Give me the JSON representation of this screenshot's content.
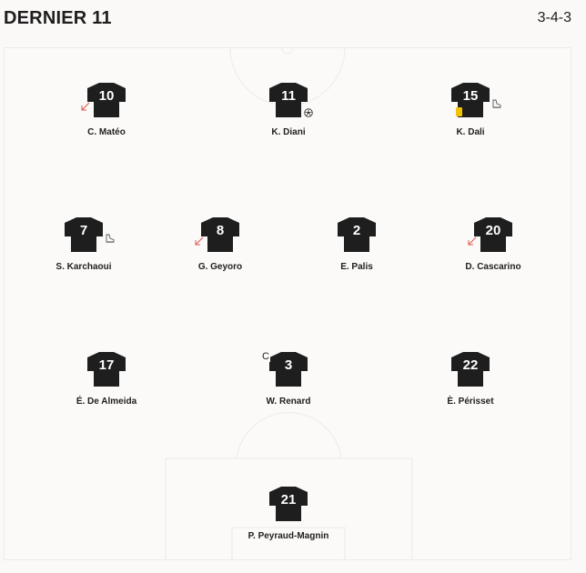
{
  "header": {
    "title": "DERNIER 11",
    "formation": "3-4-3"
  },
  "colors": {
    "shirt": "#1e1e1e",
    "sub_out": "#e0524b",
    "yellow_card": "#f2c200",
    "lines": "#ecebea"
  },
  "players": [
    {
      "number": "10",
      "name": "C. Matéo",
      "events": [
        "sub-out"
      ]
    },
    {
      "number": "11",
      "name": "K. Diani",
      "events": [
        "goal"
      ]
    },
    {
      "number": "15",
      "name": "K. Dali",
      "events": [
        "yellow-card",
        "assist"
      ]
    },
    {
      "number": "7",
      "name": "S. Karchaoui",
      "events": [
        "assist"
      ]
    },
    {
      "number": "8",
      "name": "G. Geyoro",
      "events": [
        "sub-out"
      ]
    },
    {
      "number": "2",
      "name": "E. Palis",
      "events": []
    },
    {
      "number": "20",
      "name": "D. Cascarino",
      "events": [
        "sub-out"
      ]
    },
    {
      "number": "17",
      "name": "É. De Almeida",
      "events": []
    },
    {
      "number": "3",
      "name": "W. Renard",
      "events": [],
      "captain": "C"
    },
    {
      "number": "22",
      "name": "È. Périsset",
      "events": []
    },
    {
      "number": "21",
      "name": "P. Peyraud-Magnin",
      "events": []
    }
  ]
}
